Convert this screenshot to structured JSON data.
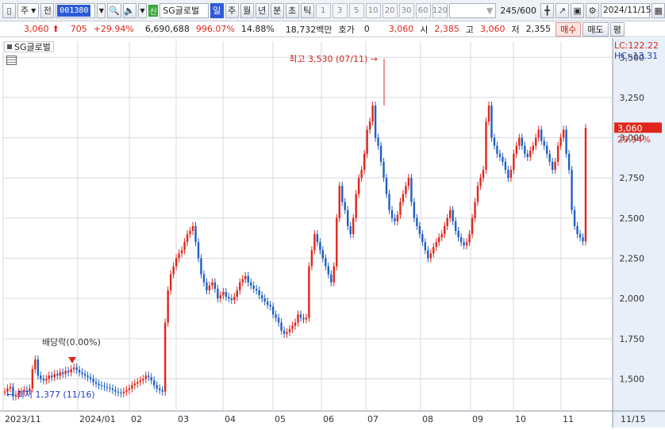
{
  "toolbar": {
    "type_label": "주",
    "prefix_label": "전",
    "stock_code": "001380",
    "sin_label": "신",
    "stock_name": "SG글로벌",
    "periods": [
      "일",
      "주",
      "월",
      "년",
      "분",
      "초",
      "틱"
    ],
    "numbers": [
      "1",
      "3",
      "5",
      "10",
      "20",
      "30",
      "60",
      "120"
    ],
    "count_label": "245",
    "count_total": "/600",
    "date": "2024/11/15"
  },
  "quote": {
    "price": "3,060",
    "change": "705",
    "change_pct": "+29.94%",
    "volume": "6,690,688",
    "volume_ratio": "996.07%",
    "turnover": "14.88%",
    "amount": "18,732백만",
    "hoga_label": "호가",
    "hoga_value": "0",
    "hoga_price": "3,060",
    "open_label": "시",
    "open_value": "2,385",
    "high_label": "고",
    "high_value": "3,060",
    "low_label": "저",
    "low_value": "2,355",
    "buy_label": "매수",
    "sell_label": "매도",
    "eval_label": "평"
  },
  "chart_legend": "SG글로벌",
  "chart_data": {
    "type": "line",
    "title": "SG글로벌",
    "x_ticks": [
      "2023/11",
      "2024/01",
      "02",
      "03",
      "04",
      "05",
      "06",
      "07",
      "08",
      "09",
      "10",
      "11",
      "11/15"
    ],
    "y_ticks": [
      1500,
      1750,
      2000,
      2250,
      2500,
      2750,
      3000,
      3250,
      3500
    ],
    "ylim": [
      1300,
      3600
    ],
    "series": [
      {
        "name": "SG글로벌",
        "values": [
          1420,
          1440,
          1450,
          1390,
          1400,
          1415,
          1420,
          1430,
          1425,
          1440,
          1560,
          1620,
          1520,
          1500,
          1490,
          1500,
          1520,
          1510,
          1530,
          1520,
          1540,
          1530,
          1550,
          1540,
          1560,
          1570,
          1555,
          1540,
          1530,
          1520,
          1510,
          1500,
          1480,
          1470,
          1460,
          1455,
          1450,
          1445,
          1440,
          1430,
          1420,
          1415,
          1410,
          1420,
          1430,
          1440,
          1460,
          1470,
          1480,
          1490,
          1500,
          1520,
          1510,
          1490,
          1460,
          1440,
          1430,
          1420,
          1850,
          2050,
          2150,
          2200,
          2250,
          2280,
          2300,
          2350,
          2400,
          2420,
          2450,
          2350,
          2250,
          2150,
          2100,
          2050,
          2080,
          2100,
          2060,
          2000,
          2020,
          2040,
          2010,
          2000,
          1990,
          2010,
          2050,
          2100,
          2120,
          2140,
          2100,
          2080,
          2060,
          2050,
          2020,
          2000,
          1980,
          1960,
          1950,
          1900,
          1880,
          1850,
          1800,
          1780,
          1790,
          1810,
          1830,
          1850,
          1900,
          1880,
          1870,
          1880,
          2200,
          2300,
          2400,
          2350,
          2300,
          2250,
          2200,
          2150,
          2100,
          2200,
          2500,
          2700,
          2600,
          2550,
          2450,
          2400,
          2500,
          2650,
          2750,
          2800,
          2900,
          3050,
          3100,
          3200,
          3000,
          2950,
          2850,
          2750,
          2650,
          2550,
          2500,
          2480,
          2520,
          2600,
          2650,
          2700,
          2750,
          2600,
          2500,
          2450,
          2400,
          2350,
          2300,
          2250,
          2280,
          2320,
          2350,
          2380,
          2400,
          2450,
          2500,
          2550,
          2480,
          2420,
          2380,
          2350,
          2330,
          2350,
          2400,
          2500,
          2600,
          2700,
          2750,
          2800,
          3100,
          3200,
          3000,
          2950,
          2900,
          2880,
          2850,
          2800,
          2750,
          2800,
          2900,
          2950,
          3000,
          2950,
          2900,
          2880,
          2920,
          2950,
          3000,
          3050,
          2980,
          2950,
          2900,
          2850,
          2800,
          2850,
          2950,
          3000,
          3050,
          2900,
          2800,
          2550,
          2450,
          2400,
          2380,
          2355,
          3060
        ]
      }
    ],
    "annotations": {
      "high": "최고 3,530 (07/11)",
      "low": "최저 1,377 (11/16)",
      "dividend": "배당락(0.00%)",
      "lc": "LC:122.22",
      "hc": "HC:-13.31",
      "last_price": "3,060",
      "last_pct": "29.94%"
    }
  }
}
